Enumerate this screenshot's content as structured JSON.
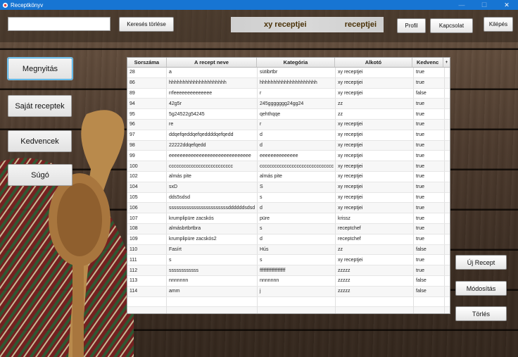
{
  "window": {
    "title": "Receptkönyv",
    "controls": [
      "—",
      "☐",
      "✕"
    ]
  },
  "toolbar": {
    "search_value": "",
    "search_placeholder": "",
    "clear_label": "Keresés törlése",
    "banner_user": "xy receptjei",
    "banner_suffix": "receptjei",
    "profile_label": "Profil",
    "contact_label": "Kapcsolat",
    "exit_label": "Kilépés"
  },
  "nav": {
    "open_label": "Megnyitás",
    "own_label": "Saját receptek",
    "favorites_label": "Kedvencek",
    "help_label": "Súgó"
  },
  "table": {
    "headers": [
      "Sorszáma",
      "A recept neve",
      "Kategória",
      "Alkotó",
      "Kedvenc"
    ],
    "corner": "+",
    "rows": [
      [
        "28",
        "a",
        "sütibrtbr",
        "xy receptjei",
        "true"
      ],
      [
        "86",
        "hhhhhhhhhhhhhhhhhhhhh",
        "hhhhhhhhhhhhhhhhhhhhh",
        "xy receptjei",
        "true"
      ],
      [
        "89",
        "rrfeeeeeeeeeeeeee",
        "r",
        "xy receptjei",
        "false"
      ],
      [
        "94",
        "42g5r",
        "245ggggggg24gg24",
        "zz",
        "true"
      ],
      [
        "95",
        "5g24522g54245",
        "qehthqqe",
        "zz",
        "true"
      ],
      [
        "96",
        "re",
        "r",
        "xy receptjei",
        "true"
      ],
      [
        "97",
        "ddqefqeddqefqeddddqefqedd",
        "d",
        "xy receptjei",
        "true"
      ],
      [
        "98",
        "22222ddqefqedd",
        "d",
        "xy receptjei",
        "true"
      ],
      [
        "99",
        "eeeeeeeeeeeeeeeeeeeeeeeeeeeeee",
        "eeeeeeeeeeeeee",
        "xy receptjei",
        "true"
      ],
      [
        "100",
        "cccccccccccccccccccccccccc",
        "cccccccccccccccccccccccccccccc",
        "xy receptjei",
        "true"
      ],
      [
        "102",
        "almás pite",
        "almás pite",
        "xy receptjei",
        "true"
      ],
      [
        "104",
        "sxD",
        "S",
        "xy receptjei",
        "true"
      ],
      [
        "105",
        "dds5sdsd",
        "s",
        "xy receptjei",
        "true"
      ],
      [
        "106",
        "ssssssssssssssssssssssssddddddsdsd",
        "d",
        "xy receptjei",
        "true"
      ],
      [
        "107",
        "krumplipüre zacskós",
        "püre",
        "krissz",
        "true"
      ],
      [
        "108",
        "almásbrtbrtbra",
        "s",
        "receptchef",
        "true"
      ],
      [
        "109",
        "krumplipüre zacskós2",
        "d",
        "receptchef",
        "true"
      ],
      [
        "110",
        "Fasírt",
        "Hús",
        "zz",
        "false"
      ],
      [
        "111",
        "s",
        "s",
        "xy receptjei",
        "true"
      ],
      [
        "112",
        "ssssssssssss",
        "ffffffffffffffffffff",
        "zzzzz",
        "true"
      ],
      [
        "113",
        "nnnnnnn",
        "nnnnnnn",
        "zzzzz",
        "false"
      ],
      [
        "114",
        "amm",
        "j",
        "zzzzz",
        "false"
      ]
    ]
  },
  "actions": {
    "new_label": "Új Recept",
    "edit_label": "Módosítás",
    "delete_label": "Törlés"
  },
  "colors": {
    "titlebar": "#1775d3",
    "banner_text": "#4a3208",
    "focus_border": "#3da6e0"
  }
}
